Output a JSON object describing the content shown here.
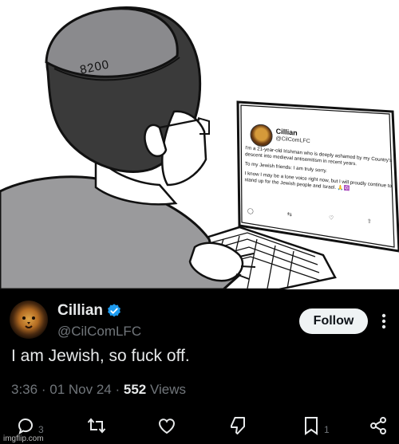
{
  "cartoon": {
    "hat_text": "8200",
    "monitor_tweet": {
      "name": "Cillian",
      "handle": "@CilComLFC",
      "paragraph_1": "I'm a 21-year-old Irishman who is deeply ashamed by my Country's descent into medieval antisemitism in recent years.",
      "paragraph_2": "To my Jewish friends: I am truly sorry.",
      "paragraph_3": "I know I may be a lone voice right now, but I will proudly continue to stand up for the Jewish people and Israel.",
      "emoji": "🙏✡️"
    }
  },
  "tweet": {
    "name": "Cillian",
    "handle": "@CilComLFC",
    "follow_label": "Follow",
    "text": "I am Jewish, so fuck off.",
    "time": "3:36",
    "date": "01 Nov 24",
    "views_count": "552",
    "views_label": "Views",
    "separator": "·",
    "reply_count": "3",
    "bookmark_count": "1",
    "icons": {
      "verified": "verified-badge-icon",
      "more": "more-options-icon",
      "reply": "reply-icon",
      "retweet": "retweet-icon",
      "like": "like-icon",
      "dislike": "downvote-icon",
      "bookmark": "bookmark-icon",
      "share": "share-icon"
    },
    "accent_color": "#1d9bf0"
  },
  "watermark": "imgflip.com"
}
